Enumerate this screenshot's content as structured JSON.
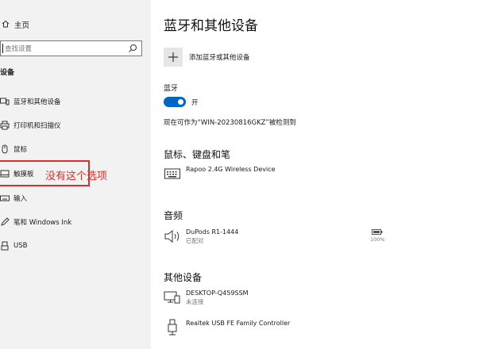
{
  "sidebar": {
    "home_label": "主页",
    "search_placeholder": "查找设置",
    "section_heading": "设备",
    "items": [
      {
        "label": "蓝牙和其他设备",
        "icon": "bluetooth-devices-icon"
      },
      {
        "label": "打印机和扫描仪",
        "icon": "printer-icon"
      },
      {
        "label": "鼠标",
        "icon": "mouse-icon"
      },
      {
        "label": "触摸板",
        "icon": "touchpad-icon"
      },
      {
        "label": "输入",
        "icon": "keyboard-icon"
      },
      {
        "label": "笔和 Windows Ink",
        "icon": "pen-icon"
      },
      {
        "label": "USB",
        "icon": "usb-icon"
      }
    ],
    "annotation": "没有这个选项",
    "annotation_color": "#e02b24"
  },
  "main": {
    "title": "蓝牙和其他设备",
    "add_label": "添加蓝牙或其他设备",
    "bluetooth_label": "蓝牙",
    "toggle_state": "开",
    "toggle_on": true,
    "accent": "#0067c0",
    "discoverable_text": "现在可作为“WIN-20230816GKZ”被检测到",
    "groups": [
      {
        "heading": "鼠标、键盘和笔",
        "devices": [
          {
            "name": "Rapoo 2.4G Wireless Device",
            "status": "",
            "icon": "keyboard-icon"
          }
        ]
      },
      {
        "heading": "音频",
        "devices": [
          {
            "name": "DuPods R1-1444",
            "status": "已配对",
            "icon": "speaker-icon",
            "battery": "100%"
          }
        ]
      },
      {
        "heading": "其他设备",
        "devices": [
          {
            "name": "DESKTOP-Q459SSM",
            "status": "未连接",
            "icon": "computer-icon"
          },
          {
            "name": "Realtek USB FE Family Controller",
            "status": "",
            "icon": "usb-device-icon"
          }
        ]
      }
    ]
  }
}
